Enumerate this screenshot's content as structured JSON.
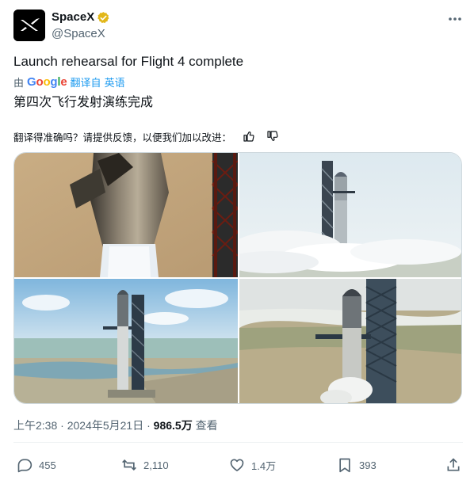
{
  "author": {
    "display_name": "SpaceX",
    "handle": "@SpaceX",
    "verified": true,
    "avatar_icon": "spacex-x-logo-icon"
  },
  "tweet": {
    "text": "Launch rehearsal for Flight 4 complete",
    "translated_by_prefix": "由",
    "translated_by_brand": "Google",
    "translated_from_label": "翻译自 英语",
    "translated_text": "第四次飞行发射演练完成",
    "feedback_prompt": "翻译得准确吗？请提供反馈，以便我们加以改进："
  },
  "media": {
    "images": [
      {
        "icon": "starship-closeup-image"
      },
      {
        "icon": "starship-on-pad-steam-image"
      },
      {
        "icon": "starship-aerial-coast-image"
      },
      {
        "icon": "starship-tower-aerial-image"
      }
    ]
  },
  "meta": {
    "time": "上午2:38",
    "sep": "·",
    "date": "2024年5月21日",
    "views": "986.5万",
    "views_label": "查看"
  },
  "actions": {
    "replies": "455",
    "reposts": "2,110",
    "likes": "1.4万",
    "bookmarks": "393"
  },
  "colors": {
    "accent": "#1d9bf0",
    "secondary_text": "#536471",
    "verified_badge": "#e2b719"
  }
}
